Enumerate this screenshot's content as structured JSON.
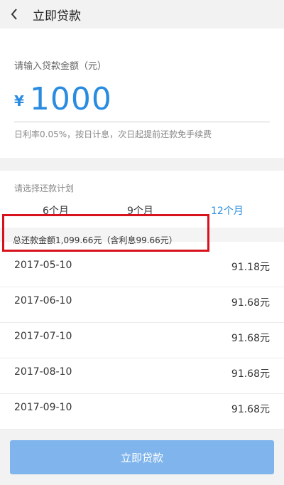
{
  "nav": {
    "title": "立即贷款"
  },
  "amount_section": {
    "label": "请输入贷款金额（元）",
    "currency": "¥",
    "amount": "1000",
    "rate_note": "日利率0.05%，按日计息，次日起提前还款免手续费"
  },
  "plan_section": {
    "label": "请选择还款计划",
    "tabs": [
      {
        "label": "6个月",
        "active": false
      },
      {
        "label": "9个月",
        "active": false
      },
      {
        "label": "12个月",
        "active": true
      }
    ],
    "total": "总还款金额1,099.66元（含利息99.66元）",
    "rows": [
      {
        "date": "2017-05-10",
        "amount": "91.18元"
      },
      {
        "date": "2017-06-10",
        "amount": "91.68元"
      },
      {
        "date": "2017-07-10",
        "amount": "91.68元"
      },
      {
        "date": "2017-08-10",
        "amount": "91.68元"
      },
      {
        "date": "2017-09-10",
        "amount": "91.68元"
      }
    ]
  },
  "action": {
    "button_label": "立即贷款"
  },
  "colors": {
    "accent": "#2a8ce0",
    "button": "#7fb5ec",
    "highlight": "#d7121d"
  }
}
